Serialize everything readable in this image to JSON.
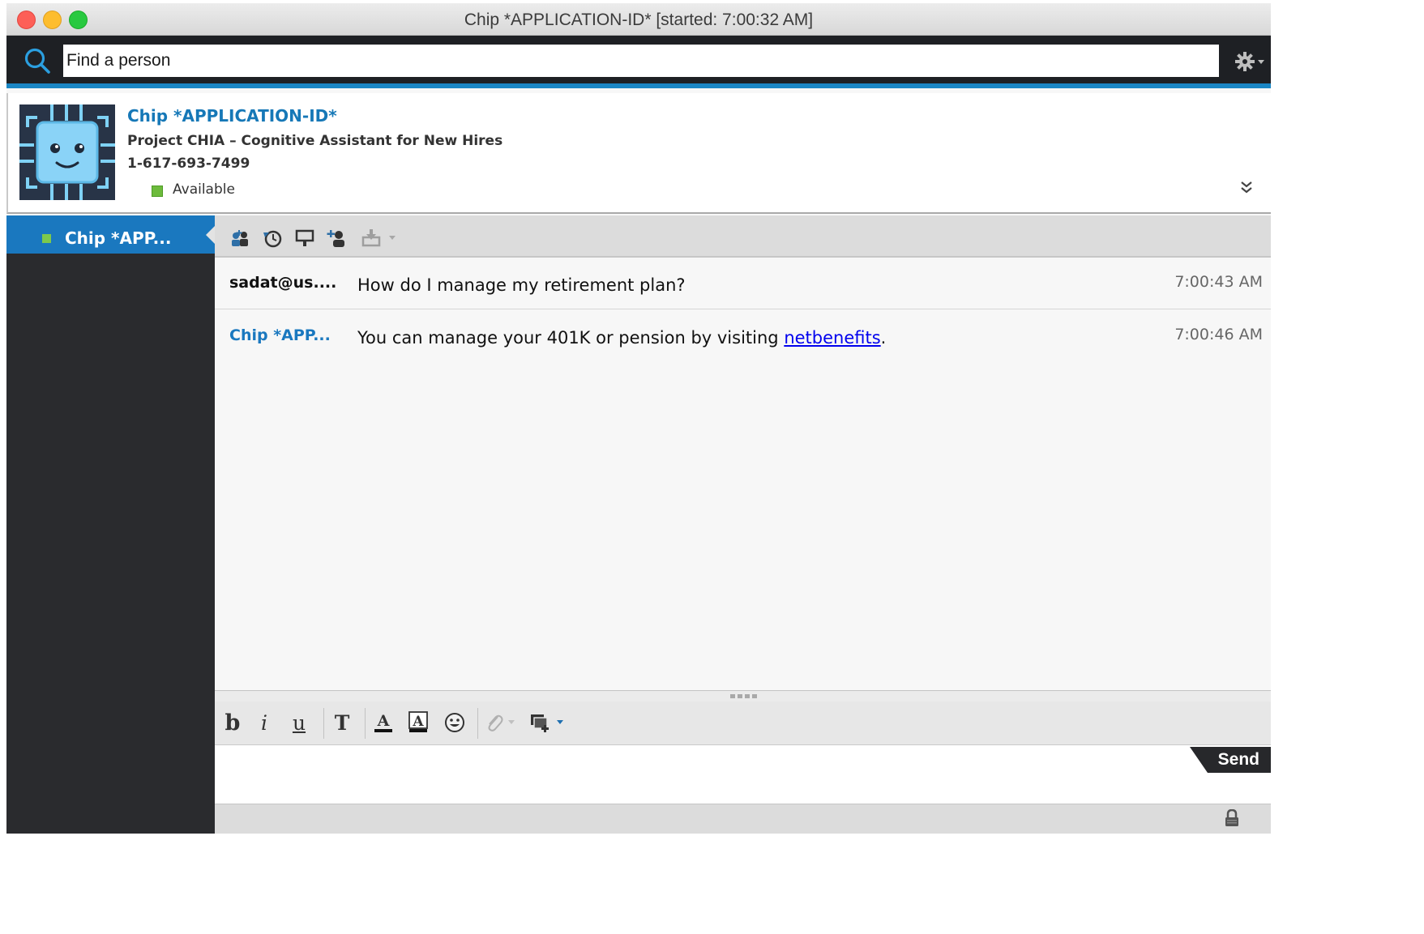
{
  "window": {
    "title": "Chip *APPLICATION-ID* [started: 7:00:32 AM]"
  },
  "search": {
    "placeholder": "Find a person"
  },
  "contact": {
    "name": "Chip *APPLICATION-ID*",
    "description": "Project CHIA – Cognitive Assistant for New Hires",
    "phone": "1-617-693-7499",
    "status": "Available"
  },
  "sidebar": {
    "items": [
      {
        "label": "Chip *APP..."
      }
    ]
  },
  "messages": [
    {
      "sender": "sadat@us....",
      "text": "How do I manage my retirement plan?",
      "time": "7:00:43 AM"
    },
    {
      "sender": "Chip *APP...",
      "text_before": "You can manage your 401K or pension by visiting ",
      "link": "netbenefits",
      "text_after": ".",
      "time": "7:00:46 AM"
    }
  ],
  "format_toolbar": {
    "bold": "b",
    "italic": "i",
    "underline": "u",
    "font": "T"
  },
  "composer": {
    "send_label": "Send"
  },
  "colors": {
    "accent": "#1a78bf",
    "status_available": "#6dbb3c",
    "link": "#0000ee"
  }
}
